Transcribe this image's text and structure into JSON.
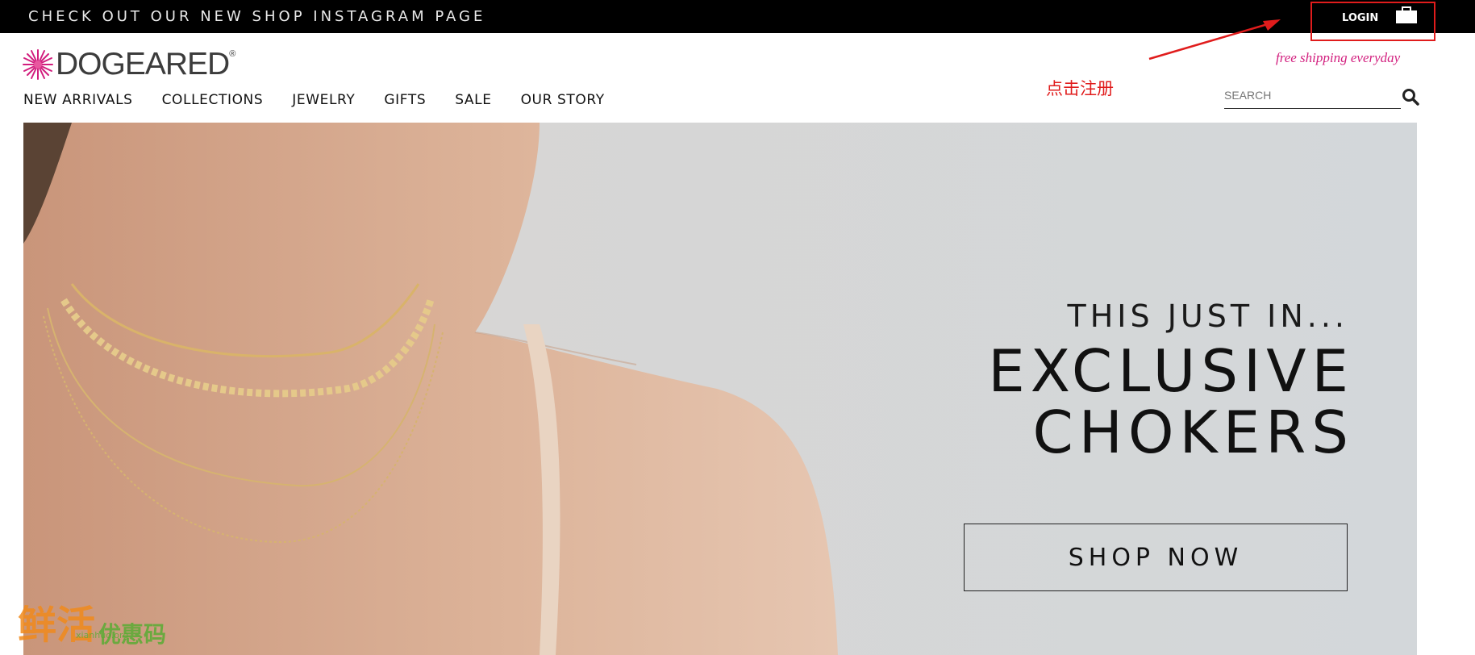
{
  "promo_bar": {
    "text": "CHECK OUT OUR NEW SHOP INSTAGRAM PAGE"
  },
  "account": {
    "login_label": "LOGIN"
  },
  "brand": {
    "logo_text": "DOGEARED",
    "registered": "®"
  },
  "shipping": {
    "text": "free shipping everyday"
  },
  "annotation": {
    "text": "点击注册",
    "color": "#e01c1c"
  },
  "nav": {
    "items": [
      {
        "label": "NEW ARRIVALS"
      },
      {
        "label": "COLLECTIONS"
      },
      {
        "label": "JEWELRY"
      },
      {
        "label": "GIFTS"
      },
      {
        "label": "SALE"
      },
      {
        "label": "OUR STORY"
      }
    ]
  },
  "search": {
    "placeholder": "SEARCH",
    "icon": "magnifier-icon"
  },
  "hero": {
    "kicker": "THIS JUST IN...",
    "headline_line1": "EXCLUSIVE",
    "headline_line2": "CHOKERS",
    "cta_label": "SHOP NOW"
  },
  "watermark": {
    "main": "鲜活",
    "side": "优惠码",
    "sub": "xianhuo.org"
  },
  "colors": {
    "accent_pink": "#d21e7e",
    "annotation_red": "#e01c1c",
    "topbar": "#000000"
  }
}
